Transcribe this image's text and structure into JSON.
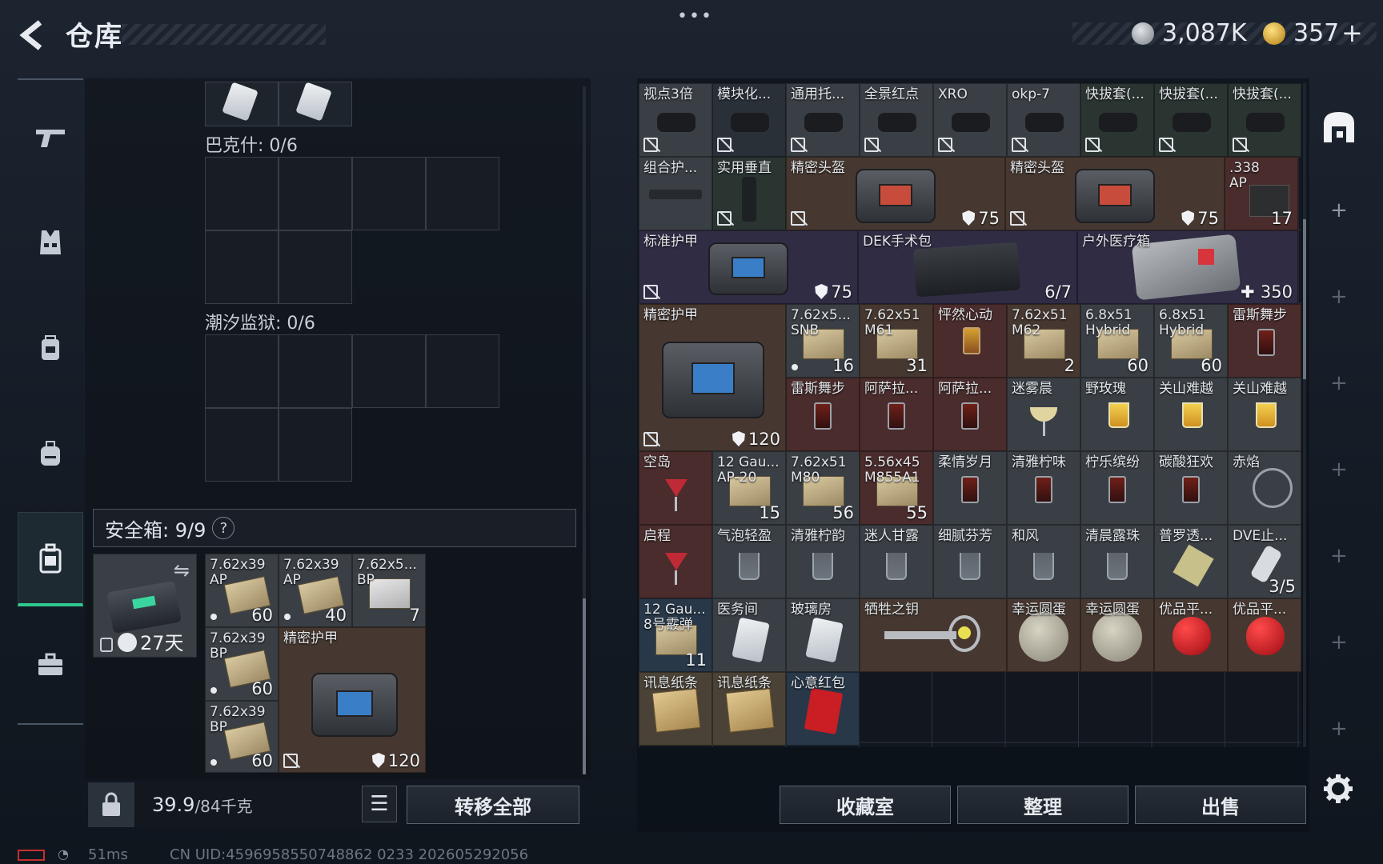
{
  "header": {
    "title": "仓库",
    "more": "•••",
    "currency1": "3,087K",
    "currency2": "357",
    "currency2_add": "+"
  },
  "sidebar": {
    "items": [
      {
        "name": "weapons",
        "icon": "gun-icon"
      },
      {
        "name": "armor",
        "icon": "vest-icon"
      },
      {
        "name": "chest-rig",
        "icon": "rig-icon"
      },
      {
        "name": "backpack",
        "icon": "backpack-icon"
      },
      {
        "name": "safe-box",
        "icon": "safe-box-icon",
        "active": true
      },
      {
        "name": "briefcase",
        "icon": "briefcase-icon"
      }
    ]
  },
  "left": {
    "slot1_label": "巴克什: 0/6",
    "slot2_label": "潮汐监狱: 0/6",
    "safe_label": "安全箱: 9/9",
    "safe_help": "?",
    "safe_timer": "27天",
    "safe_items": [
      {
        "name": "7.62x39",
        "name2": "AP",
        "qty": "60"
      },
      {
        "name": "7.62x39",
        "name2": "AP",
        "qty": "40"
      },
      {
        "name": "7.62x5...",
        "name2": "BP",
        "qty": "7"
      },
      {
        "name": "7.62x39",
        "name2": "BP",
        "qty": "60"
      },
      {
        "name": "精密护甲",
        "qty": "120"
      },
      {
        "name": "7.62x39",
        "name2": "BP",
        "qty": "60"
      }
    ],
    "weight": "39.9",
    "weight_max": "/84千克",
    "transfer_all": "转移全部"
  },
  "grid": {
    "row1": [
      "视点3倍",
      "模块化...",
      "通用托...",
      "全景红点",
      "XRO",
      "okp-7",
      "快拔套(...",
      "快拔套(...",
      "快拔套(..."
    ],
    "row2": {
      "a": "组合护...",
      "b": "实用垂直",
      "c": "精密头盔",
      "c_qty": "75",
      "d": "精密头盔",
      "d_qty": "75",
      "e": ".338",
      "e2": "AP",
      "e_qty": "17"
    },
    "row3": {
      "a": "标准护甲",
      "a_qty": "75",
      "b": "DEK手术包",
      "b_qty": "6/7",
      "c": "户外医疗箱",
      "c_qty": "350"
    },
    "row4": {
      "armor": "精密护甲",
      "armor_qty": "120",
      "items": [
        {
          "n": "7.62x5...",
          "n2": "SNB",
          "q": "16"
        },
        {
          "n": "7.62x51",
          "n2": "M61",
          "q": "31"
        },
        {
          "n": "怦然心动",
          "q": ""
        },
        {
          "n": "7.62x51",
          "n2": "M62",
          "q": "2"
        },
        {
          "n": "6.8x51",
          "n2": "Hybrid",
          "q": "60"
        },
        {
          "n": "6.8x51",
          "n2": "Hybrid",
          "q": "60"
        },
        {
          "n": "雷斯舞步",
          "q": ""
        }
      ]
    },
    "row5": [
      "雷斯舞步",
      "阿萨拉...",
      "阿萨拉...",
      "迷雾晨",
      "野玫瑰",
      "关山难越",
      "关山难越"
    ],
    "row6": [
      {
        "n": "空岛",
        "q": ""
      },
      {
        "n": "12 Gau...",
        "n2": "AP-20",
        "q": "15"
      },
      {
        "n": "7.62x51",
        "n2": "M80",
        "q": "56"
      },
      {
        "n": "5.56x45",
        "n2": "M855A1",
        "q": "55"
      },
      {
        "n": "柔情岁月",
        "q": ""
      },
      {
        "n": "清雅柠味",
        "q": ""
      },
      {
        "n": "柠乐缤纷",
        "q": ""
      },
      {
        "n": "碳酸狂欢",
        "q": ""
      },
      {
        "n": "赤焰",
        "q": ""
      }
    ],
    "row7": [
      {
        "n": "启程",
        "q": ""
      },
      {
        "n": "气泡轻盈",
        "q": ""
      },
      {
        "n": "清雅柠韵",
        "q": ""
      },
      {
        "n": "迷人甘露",
        "q": ""
      },
      {
        "n": "细腻芬芳",
        "q": ""
      },
      {
        "n": "和风",
        "q": ""
      },
      {
        "n": "清晨露珠",
        "q": ""
      },
      {
        "n": "普罗透...",
        "q": ""
      },
      {
        "n": "DVE止...",
        "q": "3/5"
      }
    ],
    "row8": [
      {
        "n": "12 Gau...",
        "n2": "8号霰弹",
        "q": "11"
      },
      {
        "n": "医务间",
        "q": ""
      },
      {
        "n": "玻璃房",
        "q": ""
      },
      {
        "n": "牺牲之钥",
        "q": ""
      },
      {
        "n": "幸运圆蛋",
        "q": ""
      },
      {
        "n": "幸运圆蛋",
        "q": ""
      },
      {
        "n": "优品平...",
        "q": ""
      },
      {
        "n": "优品平...",
        "q": ""
      }
    ],
    "row9": [
      {
        "n": "讯息纸条",
        "q": ""
      },
      {
        "n": "讯息纸条",
        "q": ""
      },
      {
        "n": "心意红包",
        "q": ""
      }
    ]
  },
  "buttons": {
    "collection": "收藏室",
    "sort": "整理",
    "sell": "出售"
  },
  "status": {
    "ping": "51ms",
    "uid": "CN UID:4596958550748862 0233 202605292056"
  },
  "colors": {
    "accent": "#2ec98f",
    "bg": "#141b25"
  }
}
